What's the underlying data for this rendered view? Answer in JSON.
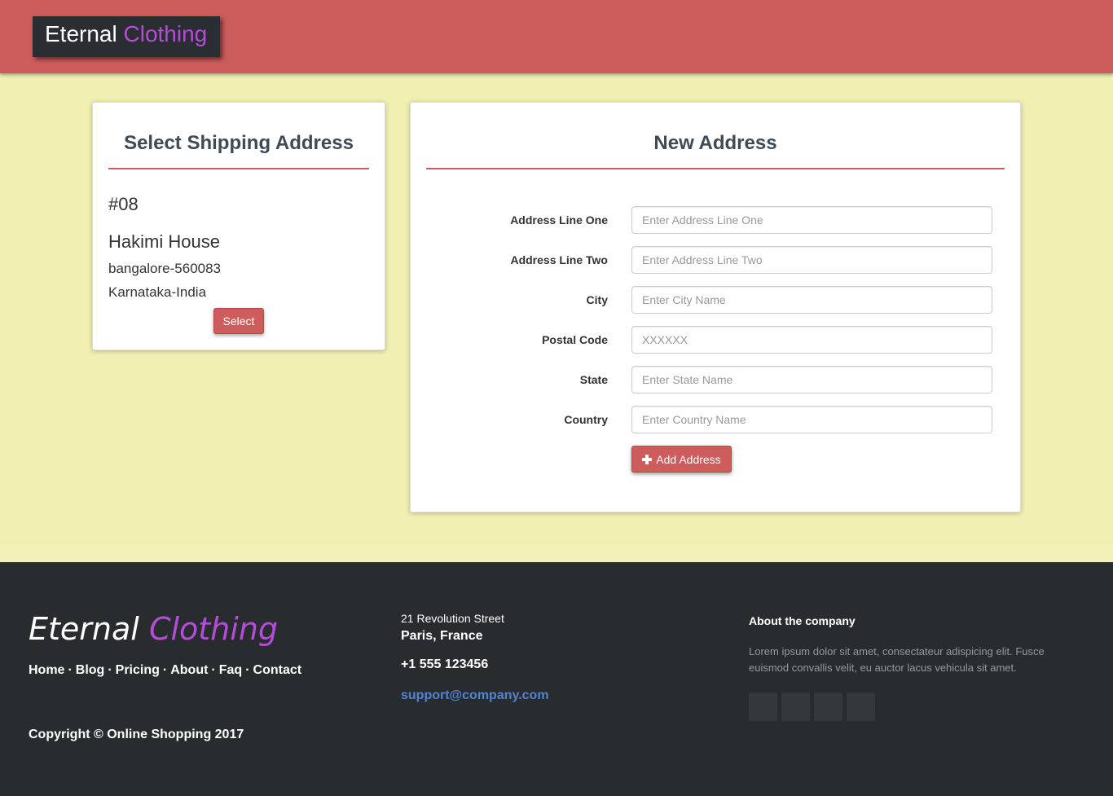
{
  "header": {
    "brand_word1": "Eternal",
    "brand_word2": "Clothing"
  },
  "shipping": {
    "title": "Select Shipping Address",
    "address": {
      "number": "#08",
      "house": "Hakimi House",
      "city_line": "bangalore-560083",
      "state_line": "Karnataka-India"
    },
    "select_label": "Select"
  },
  "new_address": {
    "title": "New Address",
    "fields": [
      {
        "label": "Address Line One",
        "placeholder": "Enter Address Line One",
        "value": ""
      },
      {
        "label": "Address Line Two",
        "placeholder": "Enter Address Line Two",
        "value": ""
      },
      {
        "label": "City",
        "placeholder": "Enter City Name",
        "value": ""
      },
      {
        "label": "Postal Code",
        "placeholder": "XXXXXX",
        "value": ""
      },
      {
        "label": "State",
        "placeholder": "Enter State Name",
        "value": ""
      },
      {
        "label": "Country",
        "placeholder": "Enter Country Name",
        "value": ""
      }
    ],
    "add_label": "Add Address",
    "add_icon": "plus-icon"
  },
  "footer": {
    "logo_word1": "Eternal",
    "logo_word2": "Clothing",
    "links": [
      "Home",
      "Blog",
      "Pricing",
      "About",
      "Faq",
      "Contact"
    ],
    "separator": "·",
    "copyright": "Copyright © Online Shopping 2017",
    "street": "21 Revolution Street",
    "city": "Paris, France",
    "phone": "+1 555 123456",
    "email": "support@company.com",
    "about_title": "About the company",
    "about_text": "Lorem ipsum dolor sit amet, consectateur adispicing elit. Fusce euismod convallis velit, eu auctor lacus vehicula sit amet.",
    "social_icons": [
      "facebook-icon",
      "twitter-icon",
      "linkedin-icon",
      "github-icon"
    ]
  },
  "colors": {
    "header_bg": "#cd5c5c",
    "page_bg": "#f2efb3",
    "accent": "#cd5c5c",
    "brand_purple": "#b54cd9",
    "footer_bg": "#292c2f",
    "link_blue": "#5383d3"
  }
}
